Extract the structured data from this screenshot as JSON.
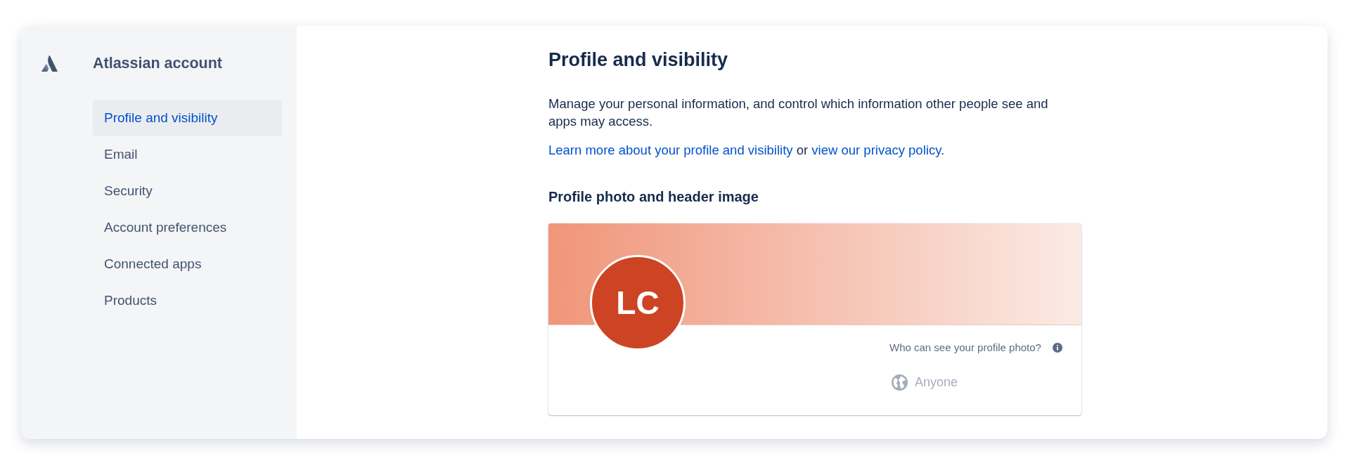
{
  "sidebar": {
    "title": "Atlassian account",
    "items": [
      {
        "label": "Profile and visibility",
        "selected": true
      },
      {
        "label": "Email",
        "selected": false
      },
      {
        "label": "Security",
        "selected": false
      },
      {
        "label": "Account preferences",
        "selected": false
      },
      {
        "label": "Connected apps",
        "selected": false
      },
      {
        "label": "Products",
        "selected": false
      }
    ]
  },
  "main": {
    "title": "Profile and visibility",
    "description": "Manage your personal information, and control which information other people see and apps may access.",
    "help_text": [
      {
        "kind": "link",
        "text": "Learn more about your profile and visibility"
      },
      {
        "kind": "text",
        "text": " or "
      },
      {
        "kind": "link",
        "text": "view our privacy policy"
      },
      {
        "kind": "text",
        "text": "."
      }
    ]
  },
  "section": {
    "title": "Profile photo and header image",
    "avatar": {
      "initials": "LC"
    },
    "visibility": {
      "label": "Who can see your profile photo?",
      "value": "Anyone",
      "disabled": true
    }
  }
}
